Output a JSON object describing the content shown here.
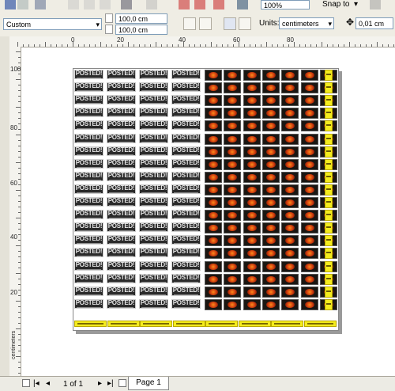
{
  "toolbar": {
    "zoom_value": "100%",
    "snap_to_label": "Snap to",
    "page_preset": "Custom",
    "page_width": "100,0 cm",
    "page_height": "100,0 cm",
    "units_label": "Units:",
    "units_value": "centimeters",
    "nudge_value": "0,01 cm"
  },
  "ruler": {
    "h_labels": [
      "0",
      "20",
      "40",
      "60",
      "80"
    ],
    "v_labels": [
      "100",
      "80",
      "60",
      "40",
      "20"
    ],
    "unit_label": "centimeters"
  },
  "artwork": {
    "poster_text": "POSTED!",
    "poster_columns": 4,
    "poster_rows": 19,
    "badge_columns": 7,
    "badge_rows": 19,
    "bottom_strip_count": 8
  },
  "status": {
    "page_counter": "1 of 1",
    "page_tab": "Page 1"
  },
  "colors": {
    "background": "#ecebe4",
    "poster": "#2a2a2a",
    "badge_accent": "#ff8a1c",
    "yellow_strip": "#f4ec1e"
  }
}
